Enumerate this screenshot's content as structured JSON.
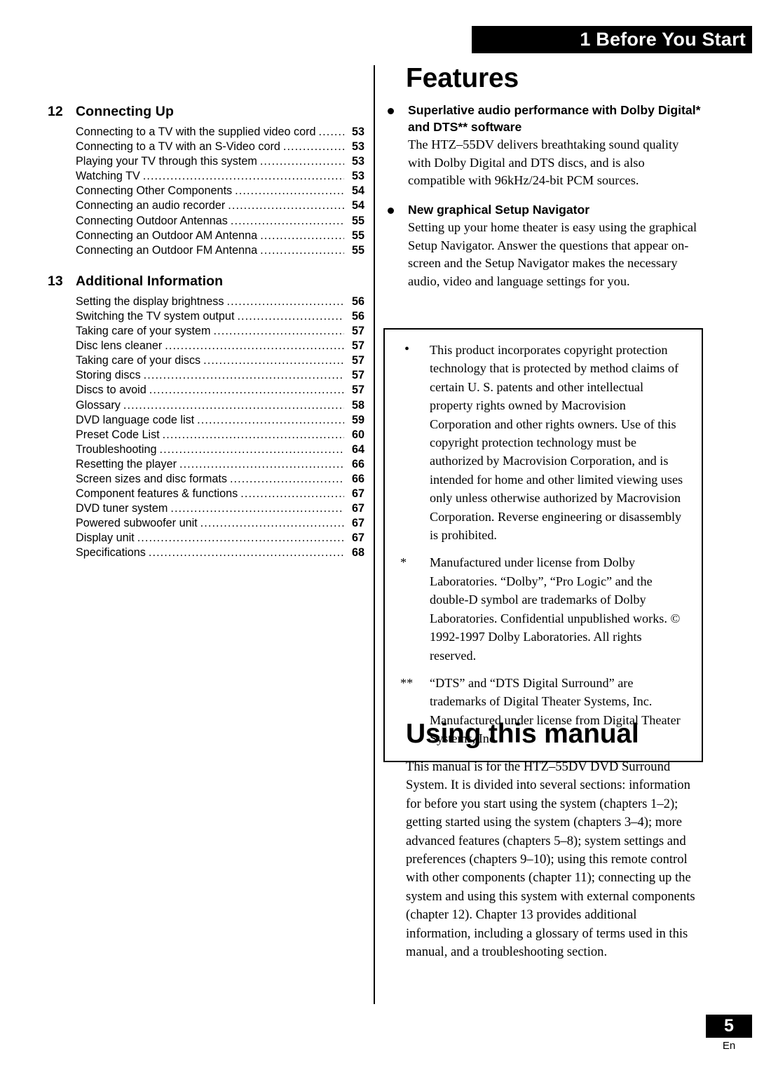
{
  "header": {
    "chapter_banner": "1 Before You Start"
  },
  "toc": {
    "sections": [
      {
        "number": "12",
        "title": "Connecting Up",
        "entries": [
          {
            "label": "Connecting to a TV with the supplied video cord",
            "page": "53"
          },
          {
            "label": "Connecting to a TV with an S-Video cord",
            "page": "53"
          },
          {
            "label": "Playing your TV through this system",
            "page": "53"
          },
          {
            "label": "Watching TV",
            "page": "53"
          },
          {
            "label": "Connecting Other Components",
            "page": "54"
          },
          {
            "label": "Connecting an audio recorder",
            "page": "54"
          },
          {
            "label": "Connecting Outdoor Antennas",
            "page": "55"
          },
          {
            "label": "Connecting an Outdoor AM Antenna",
            "page": "55"
          },
          {
            "label": "Connecting an Outdoor FM Antenna",
            "page": "55"
          }
        ]
      },
      {
        "number": "13",
        "title": "Additional Information",
        "entries": [
          {
            "label": "Setting the display brightness",
            "page": "56"
          },
          {
            "label": "Switching the TV system output",
            "page": "56"
          },
          {
            "label": "Taking care of your system",
            "page": "57"
          },
          {
            "label": "Disc lens cleaner",
            "page": "57"
          },
          {
            "label": "Taking care of your discs",
            "page": "57"
          },
          {
            "label": "Storing discs",
            "page": "57"
          },
          {
            "label": "Discs to avoid",
            "page": "57"
          },
          {
            "label": "Glossary",
            "page": "58"
          },
          {
            "label": "DVD language code list",
            "page": "59"
          },
          {
            "label": "Preset Code List",
            "page": "60"
          },
          {
            "label": "Troubleshooting",
            "page": "64"
          },
          {
            "label": "Resetting the player",
            "page": "66"
          },
          {
            "label": "Screen sizes and disc formats",
            "page": "66"
          },
          {
            "label": "Component features & functions",
            "page": "67"
          },
          {
            "label": "DVD tuner system",
            "page": "67"
          },
          {
            "label": "Powered subwoofer unit",
            "page": "67"
          },
          {
            "label": "Display unit",
            "page": "67"
          },
          {
            "label": "Specifications",
            "page": "68"
          }
        ]
      }
    ],
    "leader_dots": "........................................................................................................................"
  },
  "features": {
    "heading": "Features",
    "items": [
      {
        "title": "Superlative audio performance with Dolby Digital* and DTS** software",
        "body": "The HTZ–55DV delivers breathtaking sound quality with Dolby Digital and DTS discs, and is also compatible with 96kHz/24-bit PCM sources."
      },
      {
        "title": "New graphical Setup Navigator",
        "body": "Setting up your home theater is easy using the graphical Setup Navigator.  Answer the questions that appear on-screen and the Setup Navigator makes the necessary audio, video and language settings for you."
      }
    ]
  },
  "copyright_box": {
    "notices": [
      {
        "marker": "•",
        "text": "This product incorporates copyright protection technology that is protected by method claims of certain U. S. patents and other intellectual property rights owned by Macrovision Corporation and other rights owners. Use of this copyright protection technology must be authorized by Macrovision Corporation, and is intended for home and other limited viewing uses only unless otherwise authorized by Macrovision Corporation. Reverse engineering or disassembly is prohibited."
      },
      {
        "marker": "*",
        "text": "Manufactured under license from Dolby Laboratories. “Dolby”, “Pro Logic” and the double-D symbol are trademarks of Dolby Laboratories. Confidential unpublished works. © 1992-1997 Dolby Laboratories. All rights reserved."
      },
      {
        "marker": "**",
        "text": "“DTS” and “DTS Digital Surround” are trademarks of Digital Theater Systems, Inc. Manufactured under license from Digital Theater Systems, Inc."
      }
    ]
  },
  "using_manual": {
    "heading": "Using this manual",
    "body": "This manual is for the HTZ–55DV DVD Surround System. It is divided into several sections: information for before you start using the system (chapters 1–2); getting started using the system (chapters 3–4); more advanced features (chapters 5–8); system settings and preferences (chapters 9–10); using this remote control with other components (chapter 11); connecting up the system and using this system with external components (chapter 12). Chapter 13 provides additional information, including a glossary of terms used in this manual, and a troubleshooting section."
  },
  "footer": {
    "page_number": "5",
    "language": "En"
  }
}
